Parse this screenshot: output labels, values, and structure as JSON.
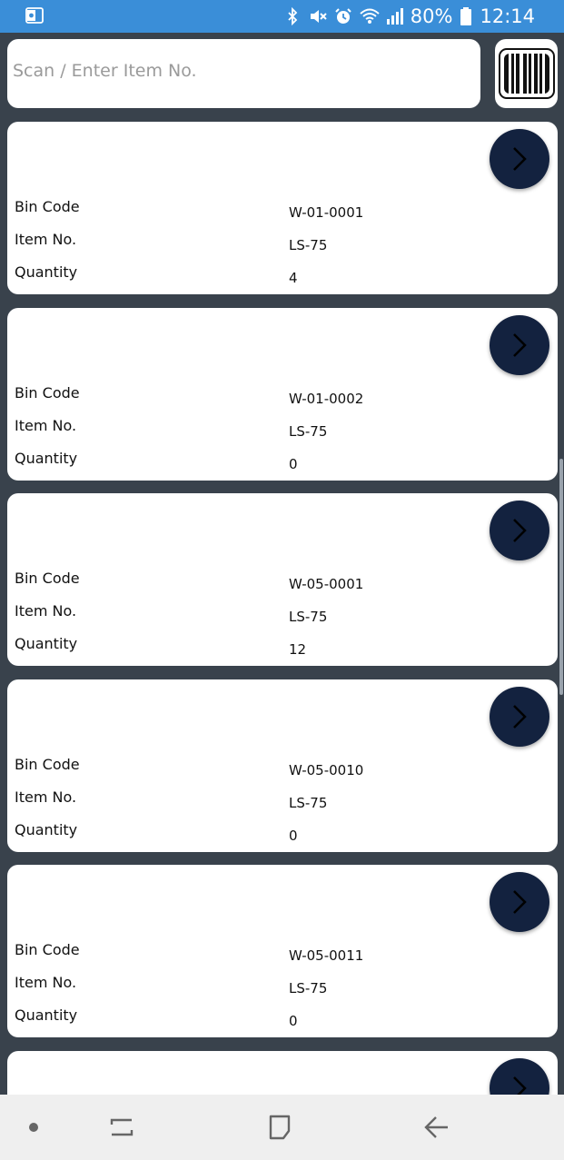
{
  "status_bar": {
    "left_icon": "outlook-icon",
    "icons": [
      "bluetooth-icon",
      "mute-icon",
      "alarm-icon",
      "wifi-icon",
      "signal-icon"
    ],
    "battery": "80%",
    "time": "12:14"
  },
  "search": {
    "placeholder": "Scan / Enter Item No.",
    "value": ""
  },
  "labels": {
    "bin_code": "Bin Code",
    "item_no": "Item No.",
    "quantity": "Quantity"
  },
  "bins": [
    {
      "bin_code": "W-01-0001",
      "item_no": "LS-75",
      "quantity": "4"
    },
    {
      "bin_code": "W-01-0002",
      "item_no": "LS-75",
      "quantity": "0"
    },
    {
      "bin_code": "W-05-0001",
      "item_no": "LS-75",
      "quantity": "12"
    },
    {
      "bin_code": "W-05-0010",
      "item_no": "LS-75",
      "quantity": "0"
    },
    {
      "bin_code": "W-05-0011",
      "item_no": "LS-75",
      "quantity": "0"
    }
  ],
  "nav": [
    "dot-icon",
    "recent-apps-icon",
    "home-icon",
    "back-icon"
  ],
  "colors": {
    "status_bar": "#3a8ed8",
    "background": "#39424c",
    "card": "#ffffff",
    "arrow_button": "#13223f",
    "nav_bar": "#efefef"
  }
}
